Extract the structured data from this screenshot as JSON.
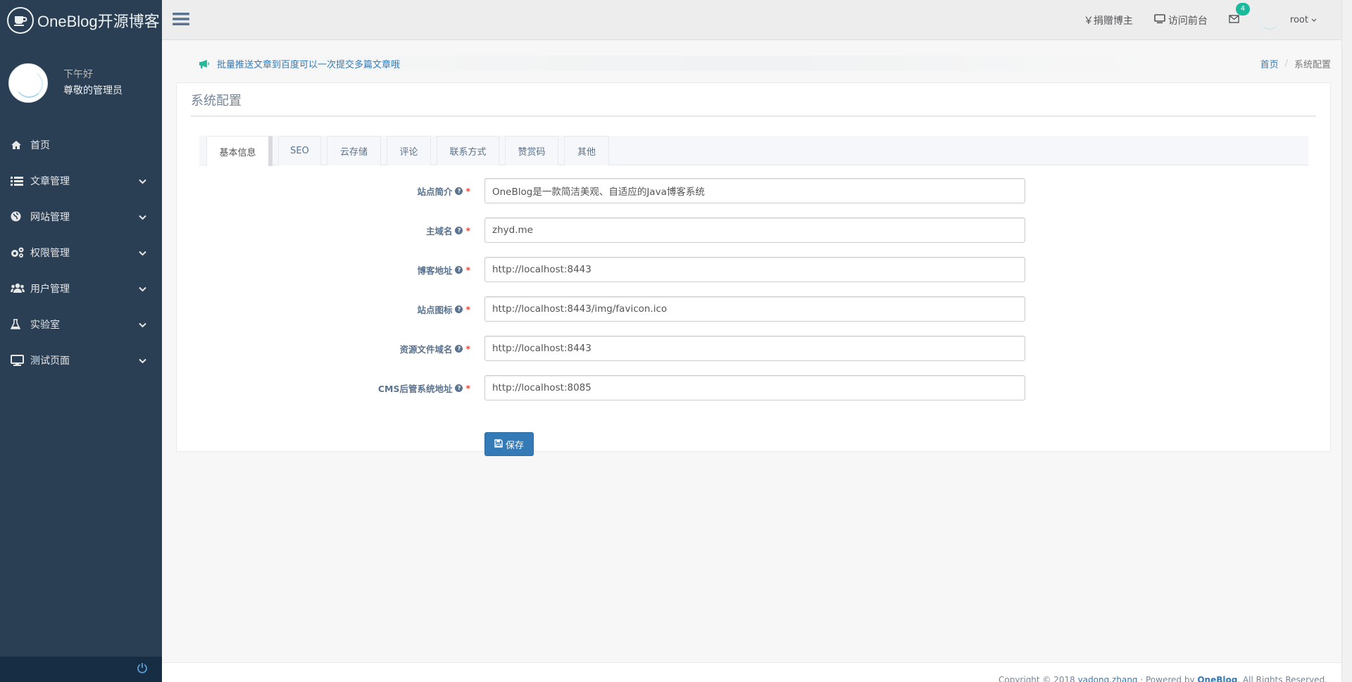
{
  "brand": {
    "title": "OneBlog开源博客",
    "icon": "coffee-cup-icon"
  },
  "profile": {
    "greeting": "下午好",
    "name": "尊敬的管理员"
  },
  "sidebar": {
    "items": [
      {
        "label": "首页",
        "icon": "home-icon",
        "has_submenu": false
      },
      {
        "label": "文章管理",
        "icon": "list-icon",
        "has_submenu": true
      },
      {
        "label": "网站管理",
        "icon": "globe-icon",
        "has_submenu": true
      },
      {
        "label": "权限管理",
        "icon": "cogs-icon",
        "has_submenu": true
      },
      {
        "label": "用户管理",
        "icon": "users-icon",
        "has_submenu": true
      },
      {
        "label": "实验室",
        "icon": "flask-icon",
        "has_submenu": true
      },
      {
        "label": "测试页面",
        "icon": "desktop-icon",
        "has_submenu": true
      }
    ]
  },
  "topnav": {
    "donate": "￥捐赠博主",
    "visit_front": "访问前台",
    "messages_count": "4",
    "user": "root"
  },
  "notice": {
    "text": "批量推送文章到百度可以一次提交多篇文章哦"
  },
  "breadcrumb": {
    "home": "首页",
    "current": "系统配置"
  },
  "panel": {
    "title": "系统配置"
  },
  "tabs": [
    {
      "label": "基本信息",
      "active": true
    },
    {
      "label": "SEO",
      "active": false
    },
    {
      "label": "云存储",
      "active": false
    },
    {
      "label": "评论",
      "active": false
    },
    {
      "label": "联系方式",
      "active": false
    },
    {
      "label": "赞赏码",
      "active": false
    },
    {
      "label": "其他",
      "active": false
    }
  ],
  "form": {
    "fields": [
      {
        "label": "站点简介",
        "value": "OneBlog是一款简洁美观、自适应的Java博客系统"
      },
      {
        "label": "主域名",
        "value": "zhyd.me"
      },
      {
        "label": "博客地址",
        "value": "http://localhost:8443"
      },
      {
        "label": "站点图标",
        "value": "http://localhost:8443/img/favicon.ico"
      },
      {
        "label": "资源文件域名",
        "value": "http://localhost:8443"
      },
      {
        "label": "CMS后管系统地址",
        "value": "http://localhost:8085"
      }
    ],
    "required_mark": "*",
    "help_mark": "?",
    "save_label": "保存"
  },
  "footer": {
    "prefix": "Copyright © 2018 ",
    "author": "yadong.zhang",
    "mid": " · Powered by ",
    "product": "OneBlog",
    "suffix": ". All Rights Reserved."
  }
}
